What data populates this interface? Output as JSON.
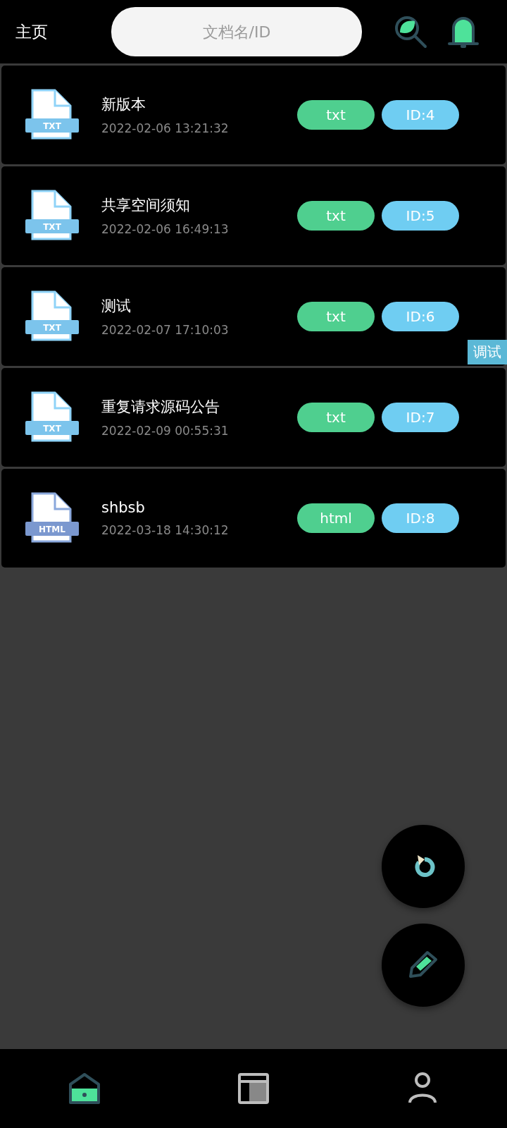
{
  "header": {
    "title": "主页",
    "search": {
      "placeholder": "文档名/ID"
    }
  },
  "documents": [
    {
      "name": "新版本",
      "date": "2022-02-06 13:21:32",
      "type": "txt",
      "id": "ID:4",
      "file_label": "TXT"
    },
    {
      "name": "共享空间须知",
      "date": "2022-02-06 16:49:13",
      "type": "txt",
      "id": "ID:5",
      "file_label": "TXT"
    },
    {
      "name": "测试",
      "date": "2022-02-07 17:10:03",
      "type": "txt",
      "id": "ID:6",
      "file_label": "TXT"
    },
    {
      "name": "重复请求源码公告",
      "date": "2022-02-09 00:55:31",
      "type": "txt",
      "id": "ID:7",
      "file_label": "TXT"
    },
    {
      "name": "shbsb",
      "date": "2022-03-18 14:30:12",
      "type": "html",
      "id": "ID:8",
      "file_label": "HTML"
    }
  ],
  "debug_tab": "调试",
  "nav": [
    {
      "kind": "home",
      "selected": true
    },
    {
      "kind": "layout",
      "selected": false
    },
    {
      "kind": "person",
      "selected": false
    }
  ]
}
